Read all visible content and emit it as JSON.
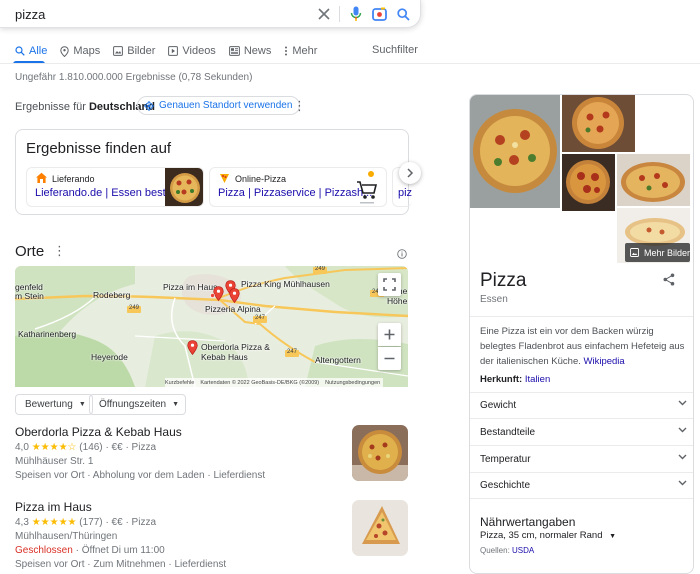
{
  "search": {
    "query": "pizza"
  },
  "tabs": [
    {
      "label": "Alle"
    },
    {
      "label": "Maps"
    },
    {
      "label": "Bilder"
    },
    {
      "label": "Videos"
    },
    {
      "label": "News"
    },
    {
      "label": "Mehr"
    }
  ],
  "search_filter": "Suchfilter",
  "result_count": "Ungefähr 1.810.000.000 Ergebnisse (0,78 Sekunden)",
  "country": {
    "prefix": "Ergebnisse für",
    "name": "Deutschland",
    "location_button": "Genauen Standort verwenden"
  },
  "find_card": {
    "title": "Ergebnisse finden auf",
    "providers": [
      {
        "name": "Lieferando",
        "link": "Lieferando.de | Essen bestelle..."
      },
      {
        "name": "Online-Pizza",
        "link": "Pizza | Pizzaservice | Pizzash..."
      },
      {
        "link": "piz"
      }
    ]
  },
  "places_section": {
    "title": "Orte"
  },
  "map": {
    "labels": {
      "genfeld": "genfeld",
      "stein": "m Stein",
      "rodeberg": "Rodeberg",
      "pizza_im_haus": "Pizza im Haus",
      "pizza_king": "Pizza King Mühlhausen",
      "pizzeria_alpina": "Pizzeria Alpina",
      "hoehe": "Höhe",
      "hoehen": "Höhen",
      "katharinenberg": "Katharinenberg",
      "heyerode": "Heyerode",
      "oberdorla_1": "Oberdorla Pizza &",
      "oberdorla_2": "Kebab Haus",
      "altengottern": "Altengottern",
      "road_249a": "249",
      "road_249b": "249",
      "road_249c": "249",
      "road_247a": "247",
      "road_247b": "247"
    },
    "attribution": {
      "shortcuts": "Kurzbefehle",
      "data": "Kartendaten © 2022 GeoBasis-DE/BKG (©2009)",
      "terms": "Nutzungsbedingungen"
    }
  },
  "filters": [
    {
      "label": "Bewertung"
    },
    {
      "label": "Öffnungszeiten"
    }
  ],
  "places": [
    {
      "name": "Oberdorla Pizza & Kebab Haus",
      "rating": "4,0",
      "stars": "★★★★☆",
      "reviews": "(146)",
      "price_type": "· €€ · Pizza",
      "address": "Mühlhäuser Str. 1",
      "status": "",
      "services": "Speisen vor Ort · Abholung vor dem Laden · Lieferdienst"
    },
    {
      "name": "Pizza im Haus",
      "rating": "4,3",
      "stars": "★★★★★",
      "reviews": "(177)",
      "price_type": "· €€ · Pizza",
      "address": "Mühlhausen/Thüringen",
      "status_closed": "Geschlossen",
      "status_open": " · Öffnet Di um 11:00",
      "services": "Speisen vor Ort · Zum Mitnehmen · Lieferdienst"
    }
  ],
  "knowledge_panel": {
    "more_images": "Mehr Bilder",
    "title": "Pizza",
    "subtitle": "Essen",
    "description": "Eine Pizza ist ein vor dem Backen würzig belegtes Fladenbrot aus einfachem Hefeteig aus der italienischen Küche.",
    "description_link": "Wikipedia",
    "origin_label": "Herkunft:",
    "origin_value": "Italien",
    "accordions": [
      {
        "label": "Gewicht"
      },
      {
        "label": "Bestandteile"
      },
      {
        "label": "Temperatur"
      },
      {
        "label": "Geschichte"
      }
    ],
    "nutrition_title": "Nährwertangaben",
    "nutrition_selector": "Pizza, 35 cm, normaler Rand",
    "source_label": "Quellen:",
    "source_value": "USDA"
  },
  "colors": {
    "accent": "#1a73e8",
    "link": "#1a0dab",
    "closed": "#d93025",
    "star": "#fbbc04",
    "map_pin": "#ea4335"
  },
  "icons": [
    "clear-icon",
    "mic-icon",
    "camera-lens-icon",
    "search-icon",
    "share-icon",
    "chevron-down-icon",
    "info-icon",
    "fullscreen-icon"
  ]
}
